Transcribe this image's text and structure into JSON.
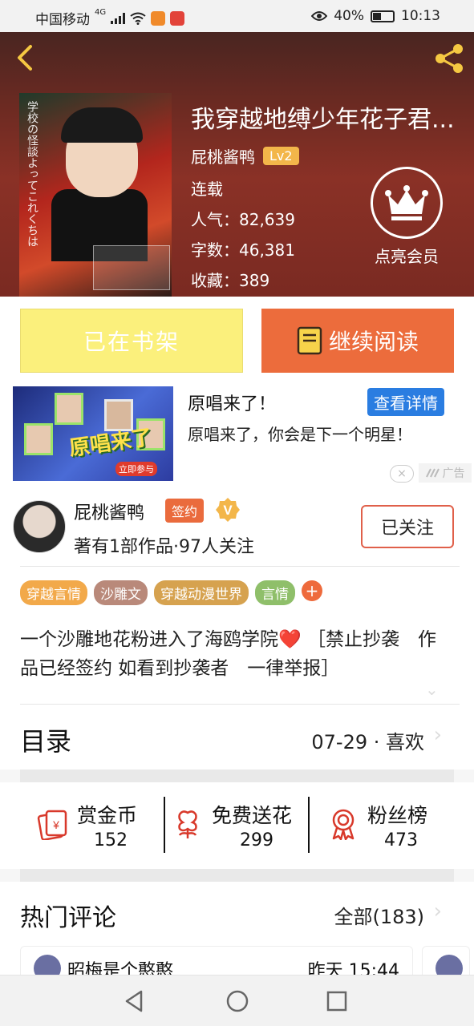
{
  "status_bar": {
    "carrier": "中国移动",
    "network": "4G",
    "battery": "40%",
    "time": "10:13"
  },
  "book": {
    "title": "我穿越地缚少年花子君...",
    "author": "屁桃酱鸭",
    "author_level": "Lv2",
    "status": "连载",
    "popularity_label": "人气：",
    "popularity": "82,639",
    "words_label": "字数：",
    "words": "46,381",
    "favorites_label": "收藏：",
    "favorites": "389",
    "vip_label": "点亮会员",
    "cover_text": "学校の怪談よってこれくちは"
  },
  "actions": {
    "shelf_label": "已在书架",
    "read_label": "继续阅读"
  },
  "ad": {
    "title": "原唱来了！",
    "detail_btn": "查看详情",
    "desc": "原唱来了，你会是下一个明星！",
    "image_logo": "原唱来了",
    "image_join": "立即参与",
    "close": "×",
    "tag": "广告"
  },
  "author": {
    "name": "屁桃酱鸭",
    "sign_badge": "签约",
    "verified_mark": "V",
    "stats": "著有1部作品·97人关注",
    "follow_label": "已关注"
  },
  "tags": [
    {
      "label": "穿越言情",
      "color": "#f2a94a"
    },
    {
      "label": "沙雕文",
      "color": "#b9897a"
    },
    {
      "label": "穿越动漫世界",
      "color": "#d6a24f"
    },
    {
      "label": "言情",
      "color": "#8fbf6a"
    }
  ],
  "tag_more": "+",
  "intro": "一个沙雕地花粉进入了海鸥学院❤️ ［禁止抄袭　作品已经签约 如看到抄袭者　一律举报］",
  "catalog": {
    "title": "目录",
    "meta": "07-29 · 喜欢"
  },
  "rewards": [
    {
      "label": "赏金币",
      "value": "152",
      "icon": "red-envelope-icon"
    },
    {
      "label": "免费送花",
      "value": "299",
      "icon": "flower-icon"
    },
    {
      "label": "粉丝榜",
      "value": "473",
      "icon": "medal-icon"
    }
  ],
  "comments": {
    "title": "热门评论",
    "all_label": "全部(183)",
    "first_user": "昭梅是个憨憨",
    "first_time": "昨天 15:44"
  },
  "colors": {
    "accent": "#ec6c3c",
    "shelf": "#fbf07c",
    "ad_button": "#2a7de1",
    "header": "#7a2a22"
  }
}
